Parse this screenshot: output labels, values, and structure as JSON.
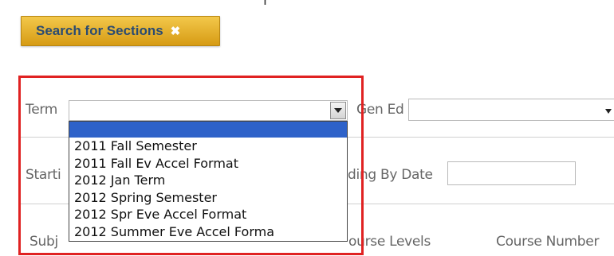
{
  "window": {
    "top_cut_text": "r"
  },
  "search_tab": {
    "label": "Search for Sections",
    "close_glyph": "✖"
  },
  "form": {
    "term_label": "Term",
    "term_value": "",
    "gen_ed_label": "Gen Ed",
    "gen_ed_value": "",
    "starting_label_partial": "Starti",
    "ending_by_date_label_partial": "ding By Date",
    "ending_by_date_value": "",
    "subjects_label_partial": "Subj",
    "course_levels_label_partial": "ourse Levels",
    "course_number_label_partial": "Course Number"
  },
  "term_dropdown": {
    "options": [
      "",
      "2011 Fall Semester",
      "2011 Fall Ev Accel Format",
      "2012 Jan Term",
      "2012 Spring Semester",
      "2012 Spr Eve Accel Format",
      "2012 Summer Eve Accel Forma"
    ]
  },
  "colors": {
    "accent_gold": "#e0ab26",
    "highlight_red": "#e02222",
    "selected_blue": "#2e62c9",
    "tab_text_blue": "#2a4b72"
  }
}
